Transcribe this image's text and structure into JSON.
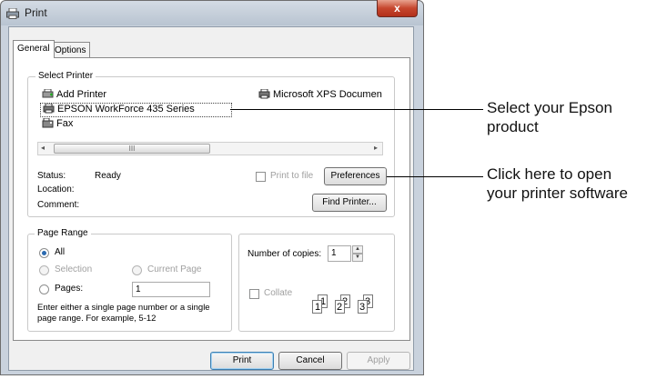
{
  "window": {
    "title": "Print",
    "close_glyph": "x"
  },
  "tabs": [
    {
      "label": "General",
      "active": true
    },
    {
      "label": "Options",
      "active": false
    }
  ],
  "select_printer": {
    "group_label": "Select Printer",
    "printers": [
      {
        "name": "Add Printer",
        "icon": "add-printer-icon"
      },
      {
        "name": "Microsoft XPS Documen",
        "icon": "printer-icon"
      },
      {
        "name": "EPSON WorkForce 435 Series",
        "icon": "printer-icon",
        "selected": true
      },
      {
        "name": "Fax",
        "icon": "fax-icon"
      }
    ],
    "scroll_thumb_glyph": "III",
    "status_label": "Status:",
    "status_value": "Ready",
    "location_label": "Location:",
    "comment_label": "Comment:",
    "print_to_file_label": "Print to file",
    "print_to_file_checked": false,
    "preferences_button": "Preferences",
    "find_printer_button": "Find Printer..."
  },
  "page_range": {
    "group_label": "Page Range",
    "all_label": "All",
    "selection_label": "Selection",
    "current_page_label": "Current Page",
    "pages_label": "Pages:",
    "pages_value": "1",
    "selected_option": "All",
    "hint_line1": "Enter either a single page number or a single",
    "hint_line2": "page range.  For example, 5-12"
  },
  "copies": {
    "label": "Number of copies:",
    "value": "1",
    "collate_label": "Collate",
    "collate_checked": false,
    "collate_icons": [
      "1",
      "1",
      "2",
      "2",
      "3",
      "3"
    ]
  },
  "footer": {
    "print_button": "Print",
    "cancel_button": "Cancel",
    "apply_button": "Apply"
  },
  "callouts": [
    {
      "line1": "Select your Epson",
      "line2": "product"
    },
    {
      "line1": "Click here to open",
      "line2": "your printer software"
    }
  ],
  "colors": {
    "accent": "#2b6ab0",
    "close": "#c6462e"
  }
}
